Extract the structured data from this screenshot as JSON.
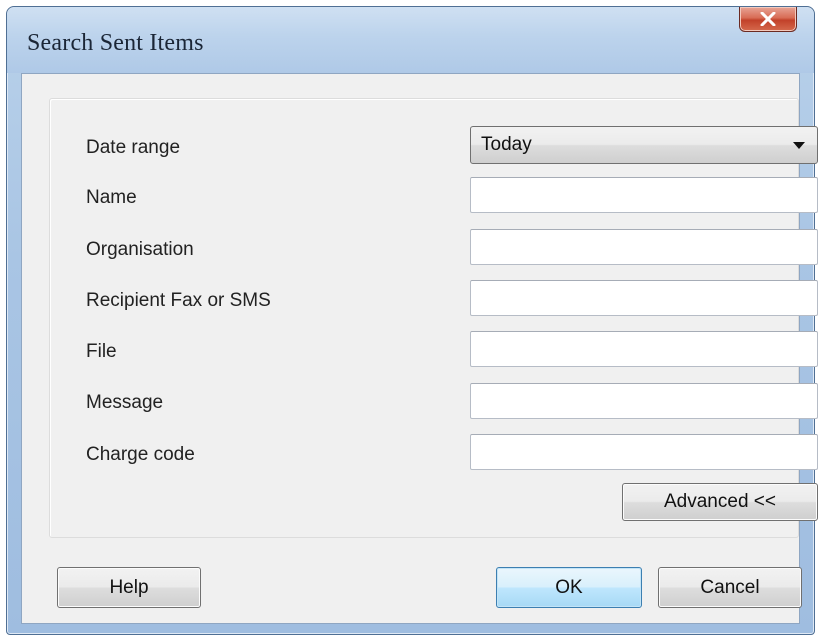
{
  "window": {
    "title": "Search Sent Items"
  },
  "form": {
    "date_range": {
      "label": "Date range",
      "value": "Today"
    },
    "name": {
      "label": "Name",
      "value": ""
    },
    "organisation": {
      "label": "Organisation",
      "value": ""
    },
    "recipient": {
      "label": "Recipient Fax or SMS",
      "value": ""
    },
    "file": {
      "label": "File",
      "value": ""
    },
    "message": {
      "label": "Message",
      "value": ""
    },
    "charge_code": {
      "label": "Charge code",
      "value": ""
    },
    "advanced_label": "Advanced <<"
  },
  "buttons": {
    "help": "Help",
    "ok": "OK",
    "cancel": "Cancel"
  },
  "icons": {
    "close": "close-icon",
    "dropdown": "chevron-down-icon"
  },
  "colors": {
    "titlebar": "#bcd3ec",
    "close_button": "#c2412a",
    "dialog_background": "#f0f0f0",
    "default_button_border": "#3c7fb1"
  }
}
